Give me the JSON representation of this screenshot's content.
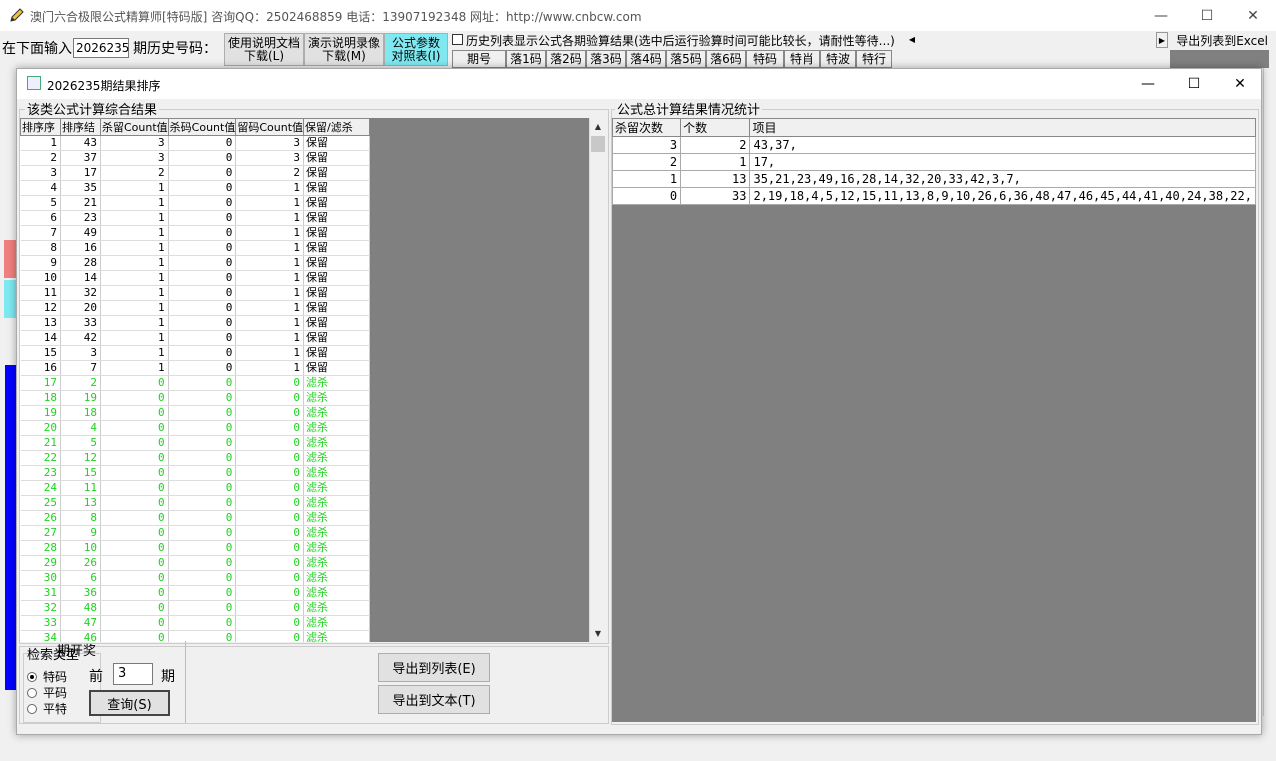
{
  "app": {
    "title": "澳门六合极限公式精算师[特码版]  咨询QQ：2502468859 电话：13907192348 网址：http://www.cnbcw.com",
    "minimize": "—",
    "maximize": "☐",
    "close": "✕"
  },
  "toolbar": {
    "input_label": "在下面输入",
    "period_value": "2026235",
    "history_label": "期历史号码：",
    "doc_btn": "使用说明文档\n下载(L)",
    "video_btn": "演示说明录像\n下载(M)",
    "formula_btn": "公式参数\n对照表(I)",
    "history_check": "历史列表显示公式各期验算结果(选中后运行验算时间可能比较长，请耐性等待...)",
    "export_excel": "导出列表到Excel",
    "columns": [
      "期号",
      "落1码",
      "落2码",
      "落3码",
      "落4码",
      "落5码",
      "落6码",
      "特码",
      "特肖",
      "特波",
      "特行"
    ]
  },
  "dialog": {
    "title": "2026235期结果排序",
    "minimize": "—",
    "maximize": "☐",
    "close": "✕",
    "left_group": "该类公式计算综合结果",
    "right_group": "公式总计算结果情况统计",
    "left_headers": [
      "排序序",
      "排序结",
      "杀留Count值",
      "杀码Count值",
      "留码Count值",
      "保留/滤杀"
    ],
    "left_rows": [
      [
        "1",
        "43",
        "3",
        "0",
        "3",
        "保留"
      ],
      [
        "2",
        "37",
        "3",
        "0",
        "3",
        "保留"
      ],
      [
        "3",
        "17",
        "2",
        "0",
        "2",
        "保留"
      ],
      [
        "4",
        "35",
        "1",
        "0",
        "1",
        "保留"
      ],
      [
        "5",
        "21",
        "1",
        "0",
        "1",
        "保留"
      ],
      [
        "6",
        "23",
        "1",
        "0",
        "1",
        "保留"
      ],
      [
        "7",
        "49",
        "1",
        "0",
        "1",
        "保留"
      ],
      [
        "8",
        "16",
        "1",
        "0",
        "1",
        "保留"
      ],
      [
        "9",
        "28",
        "1",
        "0",
        "1",
        "保留"
      ],
      [
        "10",
        "14",
        "1",
        "0",
        "1",
        "保留"
      ],
      [
        "11",
        "32",
        "1",
        "0",
        "1",
        "保留"
      ],
      [
        "12",
        "20",
        "1",
        "0",
        "1",
        "保留"
      ],
      [
        "13",
        "33",
        "1",
        "0",
        "1",
        "保留"
      ],
      [
        "14",
        "42",
        "1",
        "0",
        "1",
        "保留"
      ],
      [
        "15",
        "3",
        "1",
        "0",
        "1",
        "保留"
      ],
      [
        "16",
        "7",
        "1",
        "0",
        "1",
        "保留"
      ],
      [
        "17",
        "2",
        "0",
        "0",
        "0",
        "滤杀"
      ],
      [
        "18",
        "19",
        "0",
        "0",
        "0",
        "滤杀"
      ],
      [
        "19",
        "18",
        "0",
        "0",
        "0",
        "滤杀"
      ],
      [
        "20",
        "4",
        "0",
        "0",
        "0",
        "滤杀"
      ],
      [
        "21",
        "5",
        "0",
        "0",
        "0",
        "滤杀"
      ],
      [
        "22",
        "12",
        "0",
        "0",
        "0",
        "滤杀"
      ],
      [
        "23",
        "15",
        "0",
        "0",
        "0",
        "滤杀"
      ],
      [
        "24",
        "11",
        "0",
        "0",
        "0",
        "滤杀"
      ],
      [
        "25",
        "13",
        "0",
        "0",
        "0",
        "滤杀"
      ],
      [
        "26",
        "8",
        "0",
        "0",
        "0",
        "滤杀"
      ],
      [
        "27",
        "9",
        "0",
        "0",
        "0",
        "滤杀"
      ],
      [
        "28",
        "10",
        "0",
        "0",
        "0",
        "滤杀"
      ],
      [
        "29",
        "26",
        "0",
        "0",
        "0",
        "滤杀"
      ],
      [
        "30",
        "6",
        "0",
        "0",
        "0",
        "滤杀"
      ],
      [
        "31",
        "36",
        "0",
        "0",
        "0",
        "滤杀"
      ],
      [
        "32",
        "48",
        "0",
        "0",
        "0",
        "滤杀"
      ],
      [
        "33",
        "47",
        "0",
        "0",
        "0",
        "滤杀"
      ],
      [
        "34",
        "46",
        "0",
        "0",
        "0",
        "滤杀"
      ]
    ],
    "right_headers": [
      "杀留次数",
      "个数",
      "项目"
    ],
    "right_rows": [
      [
        "3",
        "2",
        "43,37,"
      ],
      [
        "2",
        "1",
        "17,"
      ],
      [
        "1",
        "13",
        "35,21,23,49,16,28,14,32,20,33,42,3,7,"
      ],
      [
        "0",
        "33",
        "2,19,18,4,5,12,15,11,13,8,9,10,26,6,36,48,47,46,45,44,41,40,24,38,22,"
      ]
    ],
    "search_group": "检索类型",
    "search_group_overlap": "期开奖",
    "radios": [
      "特码",
      "平码",
      "平特"
    ],
    "selected_radio": "特码",
    "prev_label": "前",
    "prev_value": "3",
    "period_unit": "期",
    "query_btn": "查询(S)",
    "export_list_btn": "导出到列表(E)",
    "export_text_btn": "导出到文本(T)"
  },
  "colors": {
    "keep_text": "#000000",
    "filter_text": "#1fd21f",
    "grid_bg": "#808080",
    "accent_cyan": "#7fe8f0",
    "blue_bar": "#0000ff"
  }
}
